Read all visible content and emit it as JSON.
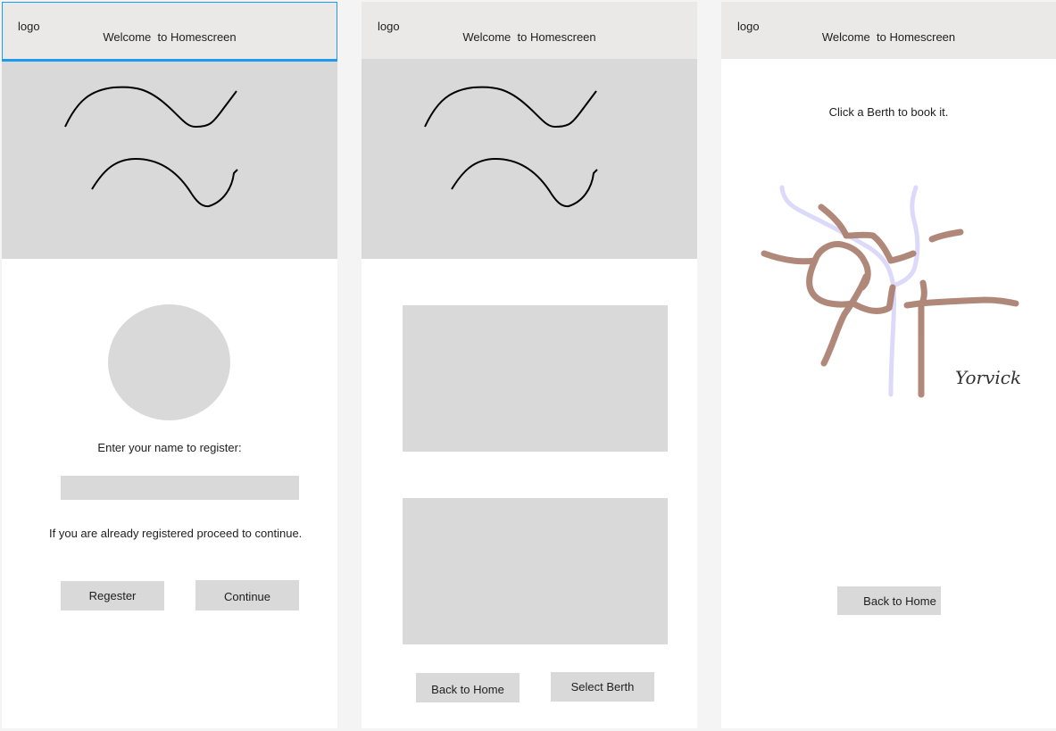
{
  "screens": [
    {
      "logo": "logo",
      "title": "Welcome  to Homescreen",
      "register_prompt": "Enter your name to register:",
      "name_input_value": "",
      "already_registered_text": "If you are already registered proceed to continue.",
      "register_button": "Regester",
      "continue_button": "Continue"
    },
    {
      "logo": "logo",
      "title": "Welcome  to Homescreen",
      "back_button": "Back to Home",
      "select_berth_button": "Select Berth"
    },
    {
      "logo": "logo",
      "title": "Welcome  to Homescreen",
      "instruction": "Click a Berth to book it.",
      "map_signature": "Yorvick",
      "back_button": "Back to Home"
    }
  ],
  "colors": {
    "header_bg": "#eae9e7",
    "placeholder_gray": "#d9d9d9",
    "selection_outline": "#1e9bf0",
    "river": "#ddd9fb",
    "roads": "#a87c6c"
  },
  "icons": [
    "hero-squiggle-drawing",
    "berth-map-image"
  ]
}
